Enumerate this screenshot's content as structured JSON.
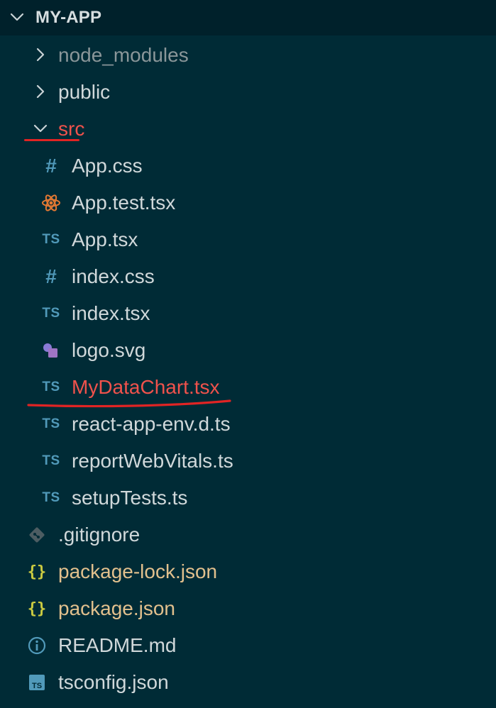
{
  "explorer": {
    "title": "MY-APP",
    "items": [
      {
        "label": "node_modules",
        "type": "folder",
        "state": "collapsed",
        "color": "#8a9699"
      },
      {
        "label": "public",
        "type": "folder",
        "state": "collapsed",
        "color": "#d0d8da"
      },
      {
        "label": "src",
        "type": "folder",
        "state": "expanded",
        "color": "#f0524c"
      },
      {
        "label": "App.css",
        "type": "file",
        "icon": "css-hash-icon",
        "color": "#d0d8da"
      },
      {
        "label": "App.test.tsx",
        "type": "file",
        "icon": "react-test-icon",
        "color": "#d0d8da"
      },
      {
        "label": "App.tsx",
        "type": "file",
        "icon": "ts-icon",
        "icon_text": "TS",
        "color": "#d0d8da"
      },
      {
        "label": "index.css",
        "type": "file",
        "icon": "css-hash-icon",
        "color": "#d0d8da"
      },
      {
        "label": "index.tsx",
        "type": "file",
        "icon": "ts-icon",
        "icon_text": "TS",
        "color": "#d0d8da"
      },
      {
        "label": "logo.svg",
        "type": "file",
        "icon": "svg-icon",
        "color": "#d0d8da"
      },
      {
        "label": "MyDataChart.tsx",
        "type": "file",
        "icon": "ts-icon",
        "icon_text": "TS",
        "color": "#f0524c"
      },
      {
        "label": "react-app-env.d.ts",
        "type": "file",
        "icon": "ts-icon",
        "icon_text": "TS",
        "color": "#d0d8da"
      },
      {
        "label": "reportWebVitals.ts",
        "type": "file",
        "icon": "ts-icon",
        "icon_text": "TS",
        "color": "#d0d8da"
      },
      {
        "label": "setupTests.ts",
        "type": "file",
        "icon": "ts-icon",
        "icon_text": "TS",
        "color": "#d0d8da"
      },
      {
        "label": ".gitignore",
        "type": "file",
        "icon": "git-icon",
        "color": "#d0d8da"
      },
      {
        "label": "package-lock.json",
        "type": "file",
        "icon": "json-braces-icon",
        "icon_text": "{}",
        "color": "#e2c08d"
      },
      {
        "label": "package.json",
        "type": "file",
        "icon": "json-braces-icon",
        "icon_text": "{}",
        "color": "#e2c08d"
      },
      {
        "label": "README.md",
        "type": "file",
        "icon": "info-icon",
        "color": "#d0d8da"
      },
      {
        "label": "tsconfig.json",
        "type": "file",
        "icon": "tsconfig-icon",
        "icon_text": "TS",
        "color": "#d0d8da"
      }
    ]
  },
  "colors": {
    "background": "#002b36",
    "header_background": "#00212b",
    "highlight_red": "#e02424",
    "ts_blue": "#519aba"
  }
}
